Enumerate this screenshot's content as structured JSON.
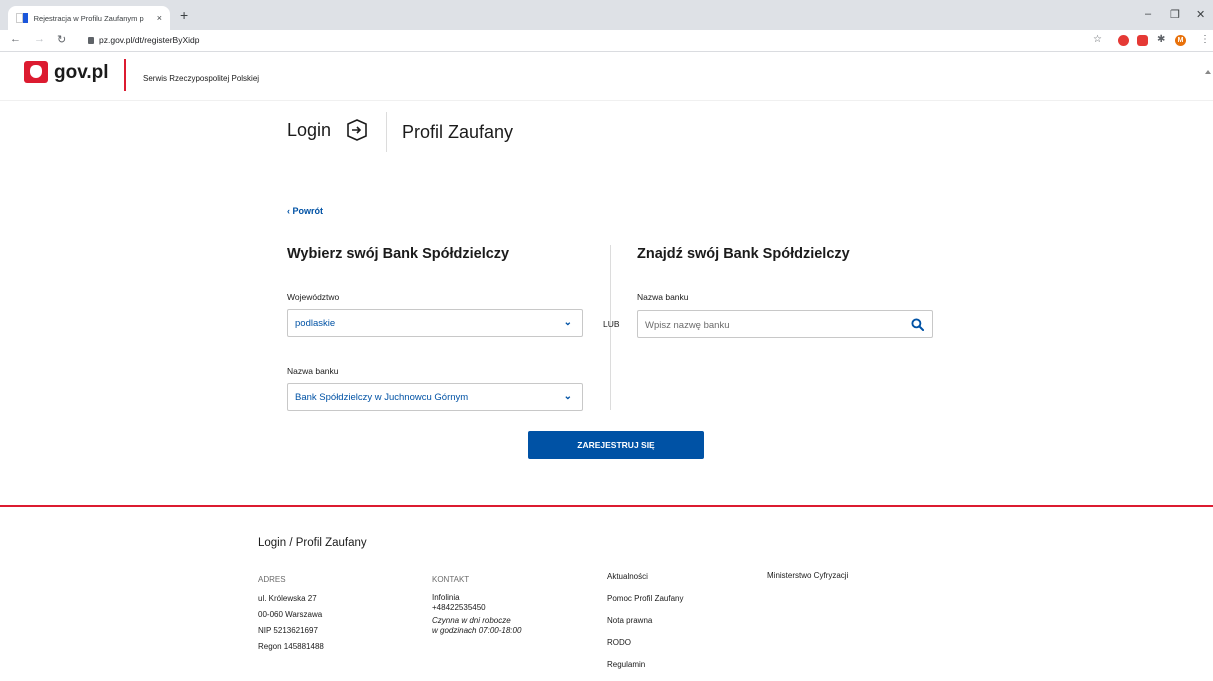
{
  "browser": {
    "tab_title": "Rejestracja w Profilu Zaufanym p",
    "tab_close": "×",
    "new_tab": "+",
    "url": "pz.gov.pl/dt/registerByXidp",
    "profile_initial": "M",
    "win_minimize": "–",
    "win_restore": "❐",
    "win_close": "✕"
  },
  "header": {
    "logo_text": "gov.pl",
    "service_name": "Serwis Rzeczypospolitej Polskiej"
  },
  "brand": {
    "login": "Login",
    "profile": "Profil Zaufany"
  },
  "back_link": "‹ Powrót",
  "left": {
    "heading": "Wybierz swój Bank Spółdzielczy",
    "voivodeship_label": "Województwo",
    "voivodeship_value": "podlaskie",
    "bank_label": "Nazwa banku",
    "bank_value": "Bank Spółdzielczy w Juchnowcu Górnym"
  },
  "or_text": "LUB",
  "right": {
    "heading": "Znajdź swój Bank Spółdzielczy",
    "bank_label": "Nazwa banku",
    "search_placeholder": "Wpisz nazwę banku",
    "search_value": ""
  },
  "submit_label": "ZAREJESTRUJ SIĘ",
  "footer": {
    "title": "Login / Profil Zaufany",
    "address_heading": "ADRES",
    "address_lines": [
      "ul. Królewska 27",
      "00-060 Warszawa",
      "NIP 5213621697",
      "Regon 145881488"
    ],
    "contact_heading": "KONTAKT",
    "contact_name": "Infolinia",
    "contact_phone": "+48422535450",
    "contact_hours_1": "Czynna w dni robocze",
    "contact_hours_2": "w godzinach 07:00-18:00",
    "links": [
      "Aktualności",
      "Pomoc Profil Zaufany",
      "Nota prawna",
      "RODO",
      "Regulamin"
    ],
    "ministry": "Ministerstwo Cyfryzacji"
  },
  "colors": {
    "accent_blue": "#0052a5",
    "brand_red": "#dc1b30"
  }
}
